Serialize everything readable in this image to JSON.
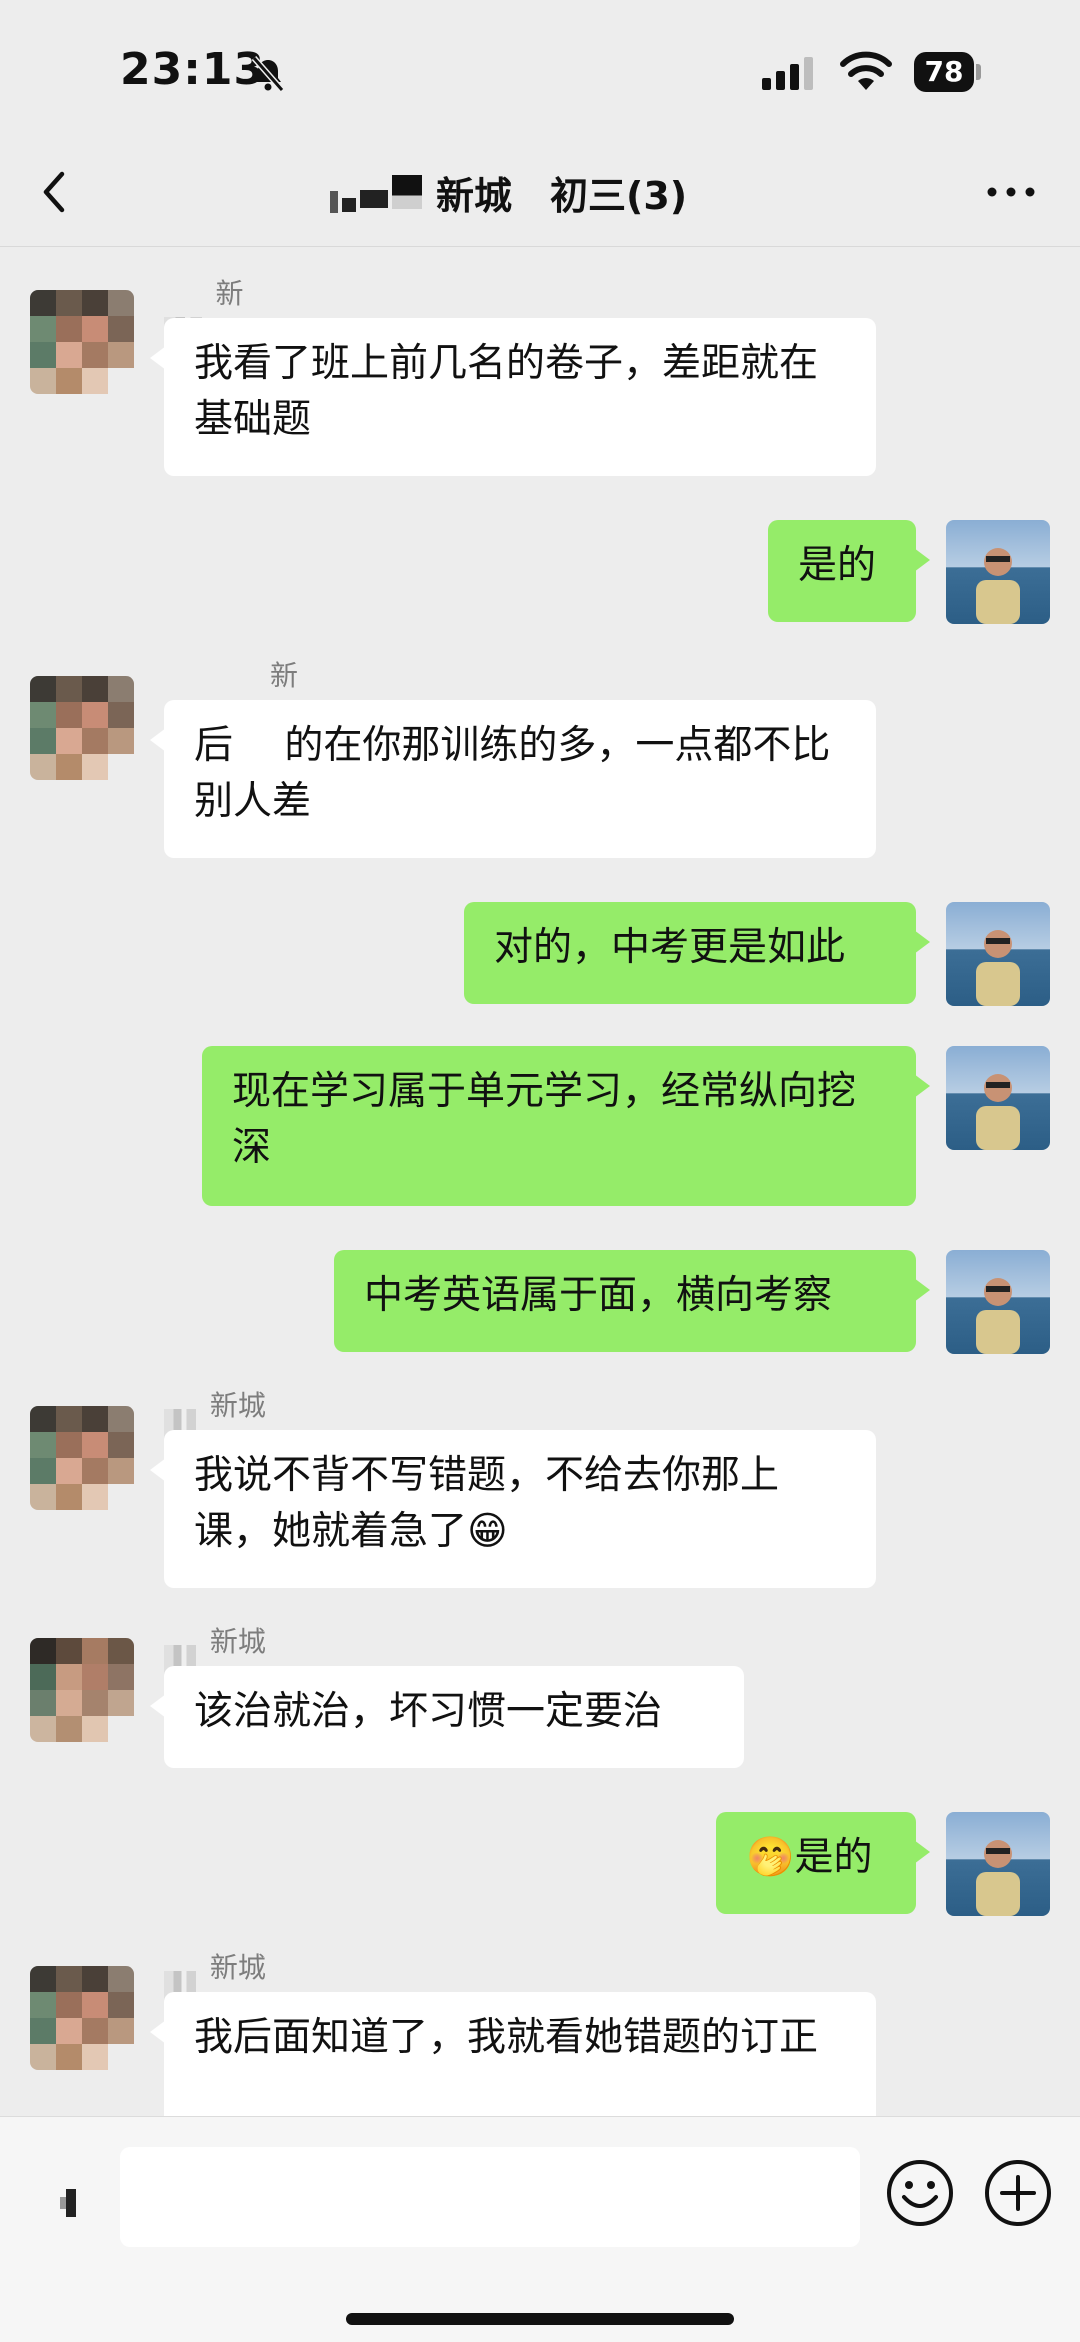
{
  "status_bar": {
    "time": "23:13",
    "battery": "78"
  },
  "nav": {
    "title": "新城　初三(3)"
  },
  "messages": [
    {
      "side": "in",
      "sender": "新城  初",
      "text": "我看了班上前几名的卷子，差距就在基础题"
    },
    {
      "side": "out",
      "text": "是的"
    },
    {
      "side": "in",
      "sender": "新城  初三",
      "text": "后　 的在你那训练的多，一点都不比别人差"
    },
    {
      "side": "out",
      "text": "对的，中考更是如此"
    },
    {
      "side": "out",
      "text": "现在学习属于单元学习，经常纵向挖深"
    },
    {
      "side": "out",
      "text": "中考英语属于面，横向考察"
    },
    {
      "side": "in",
      "sender": "新城  初三",
      "text": "我说不背不写错题，不给去你那上课，她就着急了😁"
    },
    {
      "side": "in",
      "sender": "新城  初三",
      "text": "该治就治，坏习惯一定要治"
    },
    {
      "side": "out",
      "text": "🤭是的"
    },
    {
      "side": "in",
      "sender": "新城  初三",
      "text": "我后面知道了，我就看她错题的订正"
    }
  ],
  "input": {
    "placeholder": ""
  },
  "colors": {
    "outgoing_bubble": "#95ec69",
    "incoming_bubble": "#ffffff",
    "background": "#ededed"
  },
  "icons": [
    "mute-icon",
    "signal-icon",
    "wifi-icon",
    "back-arrow-icon",
    "more-dots-icon",
    "voice-icon",
    "emoji-icon",
    "plus-icon"
  ]
}
